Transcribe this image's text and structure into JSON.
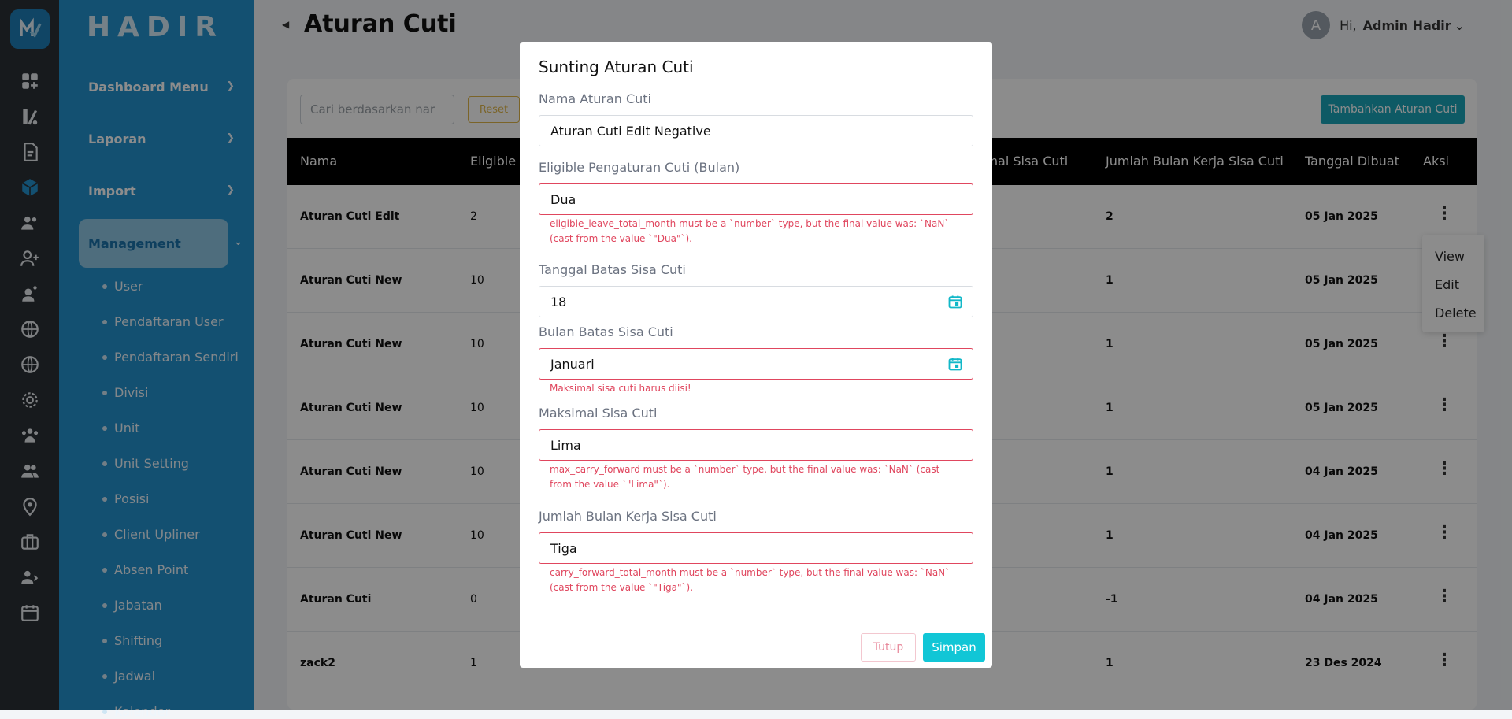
{
  "app": {
    "brand": "HADIR"
  },
  "sidebar": {
    "nav": [
      {
        "label": "Dashboard Menu"
      },
      {
        "label": "Laporan"
      },
      {
        "label": "Import"
      },
      {
        "label": "Management"
      }
    ],
    "subitems": [
      "User",
      "Pendaftaran User",
      "Pendaftaran Sendiri",
      "Divisi",
      "Unit",
      "Unit Setting",
      "Posisi",
      "Client Upliner",
      "Absen Point",
      "Jabatan",
      "Shifting",
      "Jadwal",
      "Kalender"
    ]
  },
  "header": {
    "title": "Aturan Cuti",
    "avatar_letter": "A",
    "greeting": "Hi,",
    "user_name": "Admin Hadir"
  },
  "toolbar": {
    "search_placeholder": "Cari berdasarkan nar",
    "reset_label": "Reset",
    "add_label": "Tambahkan Aturan Cuti"
  },
  "table": {
    "columns": [
      "Nama",
      "Eligible P",
      "imal Sisa Cuti",
      "Jumlah Bulan Kerja Sisa Cuti",
      "Tanggal Dibuat",
      "Aksi"
    ],
    "rows": [
      {
        "nama": "Aturan Cuti Edit",
        "eligible": "2",
        "jumlah": "2",
        "tanggal": "05 Jan 2025"
      },
      {
        "nama": "Aturan Cuti New",
        "eligible": "10",
        "jumlah": "1",
        "tanggal": "05 Jan 2025"
      },
      {
        "nama": "Aturan Cuti New",
        "eligible": "10",
        "jumlah": "1",
        "tanggal": "05 Jan 2025"
      },
      {
        "nama": "Aturan Cuti New",
        "eligible": "10",
        "jumlah": "1",
        "tanggal": "05 Jan 2025"
      },
      {
        "nama": "Aturan Cuti New",
        "eligible": "10",
        "jumlah": "1",
        "tanggal": "04 Jan 2025"
      },
      {
        "nama": "Aturan Cuti New",
        "eligible": "10",
        "jumlah": "1",
        "tanggal": "04 Jan 2025"
      },
      {
        "nama": "Aturan Cuti",
        "eligible": "0",
        "jumlah": "-1",
        "tanggal": "04 Jan 2025"
      },
      {
        "nama": "zack2",
        "eligible": "1",
        "jumlah": "1",
        "tanggal": "23 Des 2024"
      }
    ]
  },
  "action_menu": {
    "view": "View",
    "edit": "Edit",
    "delete": "Delete"
  },
  "modal": {
    "title": "Sunting Aturan Cuti",
    "fields": {
      "nama": {
        "label": "Nama Aturan Cuti",
        "value": "Aturan Cuti Edit Negative"
      },
      "eligible": {
        "label": "Eligible Pengaturan Cuti (Bulan)",
        "value": "Dua",
        "error": "eligible_leave_total_month must be a `number` type, but the final value was: `NaN` (cast from the value `\"Dua\"`)."
      },
      "tanggal_batas": {
        "label": "Tanggal Batas Sisa Cuti",
        "value": "18"
      },
      "bulan_batas": {
        "label": "Bulan Batas Sisa Cuti",
        "value": "Januari",
        "error": "Maksimal sisa cuti harus diisi!"
      },
      "maksimal": {
        "label": "Maksimal Sisa Cuti",
        "value": "Lima",
        "error": "max_carry_forward must be a `number` type, but the final value was: `NaN` (cast from the value `\"Lima\"`)."
      },
      "jumlah_bulan": {
        "label": "Jumlah Bulan Kerja Sisa Cuti",
        "value": "Tiga",
        "error": "carry_forward_total_month must be a `number` type, but the final value was: `NaN` (cast from the value `\"Tiga\"`)."
      }
    },
    "close_label": "Tutup",
    "save_label": "Simpan"
  },
  "colors": {
    "sidebar": "#2392ce",
    "rail": "#2b3036",
    "accent": "#11c6d6",
    "error": "#e0465e"
  }
}
